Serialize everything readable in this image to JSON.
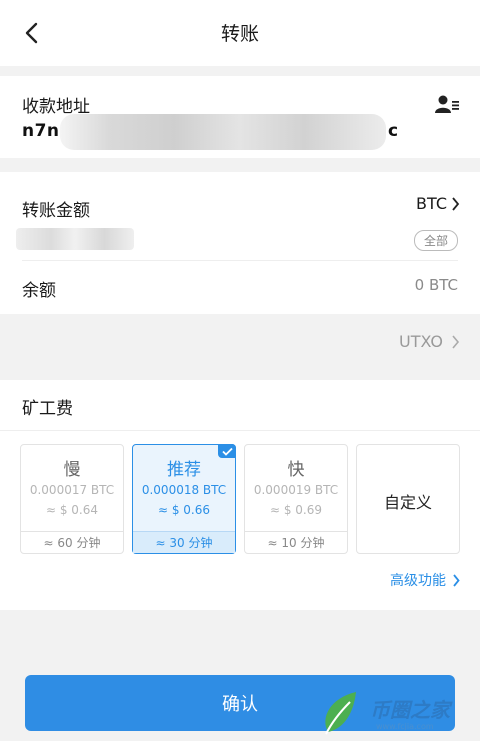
{
  "header": {
    "title": "转账"
  },
  "address": {
    "label": "收款地址",
    "value_start": "n7na",
    "value_end": "c"
  },
  "amount": {
    "label": "转账金额",
    "currency": "BTC",
    "all_label": "全部"
  },
  "balance": {
    "label": "余额",
    "value": "0 BTC"
  },
  "utxo": {
    "label": "UTXO"
  },
  "fee": {
    "label": "矿工费",
    "options": [
      {
        "name": "慢",
        "btc": "0.000017 BTC",
        "usd": "≈ $ 0.64",
        "time": "≈ 60 分钟",
        "selected": false
      },
      {
        "name": "推荐",
        "btc": "0.000018 BTC",
        "usd": "≈ $ 0.66",
        "time": "≈ 30 分钟",
        "selected": true
      },
      {
        "name": "快",
        "btc": "0.000019 BTC",
        "usd": "≈ $ 0.69",
        "time": "≈ 10 分钟",
        "selected": false
      }
    ],
    "custom_label": "自定义"
  },
  "advanced": {
    "label": "高级功能"
  },
  "confirm": {
    "label": "确认"
  },
  "watermark": {
    "text": "币圈之家",
    "url": "www.fcjia.com"
  },
  "colors": {
    "accent": "#2f8de4",
    "selected_bg": "#eaf4fd"
  },
  "icons": [
    "back-arrow-icon",
    "contact-book-icon",
    "chevron-right-icon",
    "checkmark-icon"
  ]
}
